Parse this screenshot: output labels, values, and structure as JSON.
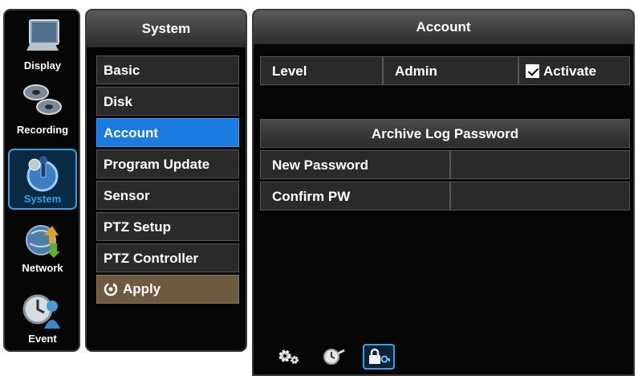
{
  "rail": {
    "items": [
      {
        "label": "Display",
        "icon": "monitor-icon"
      },
      {
        "label": "Recording",
        "icon": "film-reels-icon"
      },
      {
        "label": "System",
        "icon": "system-joystick-icon",
        "active": true
      },
      {
        "label": "Network",
        "icon": "globe-arrows-icon"
      },
      {
        "label": "Event",
        "icon": "clock-person-icon"
      }
    ]
  },
  "menu": {
    "title": "System",
    "items": [
      "Basic",
      "Disk",
      "Account",
      "Program Update",
      "Sensor",
      "PTZ Setup",
      "PTZ Controller"
    ],
    "active_item": "Account",
    "apply_label": "Apply"
  },
  "panel": {
    "title": "Account",
    "level_label": "Level",
    "level_value": "Admin",
    "activate_label": "Activate",
    "activate_checked": true,
    "archive_title": "Archive Log Password",
    "new_password_label": "New Password",
    "new_password_value": "",
    "confirm_label": "Confirm PW",
    "confirm_value": "",
    "tabs": [
      "gears-icon",
      "clock-wrench-icon",
      "lock-key-icon"
    ],
    "active_tab": "lock-key-icon"
  },
  "colors": {
    "accent": "#1a7be0",
    "highlight_border": "#3aa0e0",
    "apply_bg": "#6e5a3e",
    "background": "#050505"
  }
}
